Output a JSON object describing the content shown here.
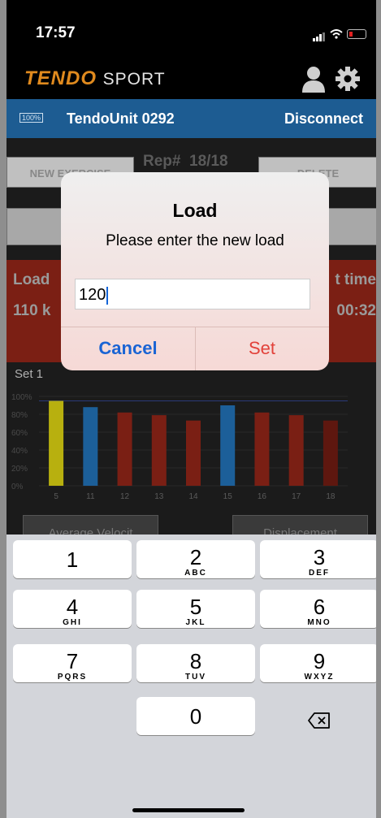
{
  "status_bar": {
    "time": "17:57"
  },
  "app_header": {
    "logo_main": "TENDO",
    "logo_sub": "SPORT",
    "profile_icon": "person-icon",
    "settings_icon": "gear-icon"
  },
  "device_bar": {
    "battery": "100%",
    "unit_name": "TendoUnit 0292",
    "disconnect_label": "Disconnect"
  },
  "background": {
    "rep_label": "Rep#",
    "rep_value": "18/18",
    "new_exercise_label": "NEW EXERCISE",
    "delete_label": "DELETE",
    "load_label": "Load",
    "load_value": "110 k",
    "time_label": "t time",
    "time_value": "00:32",
    "set_label": "Set 1",
    "avg_velocity_label": "Average Velocit",
    "displacement_label": "Displacement"
  },
  "chart_data": {
    "type": "bar",
    "categories": [
      "5",
      "11",
      "12",
      "13",
      "14",
      "15",
      "16",
      "17",
      "18"
    ],
    "values": [
      95,
      88,
      82,
      79,
      73,
      90,
      82,
      79,
      73
    ],
    "colors": [
      "#b8b00f",
      "#1c5f99",
      "#7a1f14",
      "#7a1f14",
      "#7a1f14",
      "#1c5f99",
      "#7a1f14",
      "#7a1f14",
      "#5e170f"
    ],
    "y_ticks": [
      "100%",
      "80%",
      "60%",
      "40%",
      "20%",
      "0%"
    ],
    "ylim": [
      0,
      100
    ],
    "reference_line": 95
  },
  "dialog": {
    "title": "Load",
    "message": "Please enter the new load",
    "input_value": "120",
    "cancel_label": "Cancel",
    "set_label": "Set"
  },
  "keypad": {
    "keys": [
      {
        "digit": "1",
        "letters": ""
      },
      {
        "digit": "2",
        "letters": "ABC"
      },
      {
        "digit": "3",
        "letters": "DEF"
      },
      {
        "digit": "4",
        "letters": "GHI"
      },
      {
        "digit": "5",
        "letters": "JKL"
      },
      {
        "digit": "6",
        "letters": "MNO"
      },
      {
        "digit": "7",
        "letters": "PQRS"
      },
      {
        "digit": "8",
        "letters": "TUV"
      },
      {
        "digit": "9",
        "letters": "WXYZ"
      },
      {
        "digit": "0",
        "letters": ""
      }
    ],
    "backspace_icon": "backspace-icon"
  }
}
